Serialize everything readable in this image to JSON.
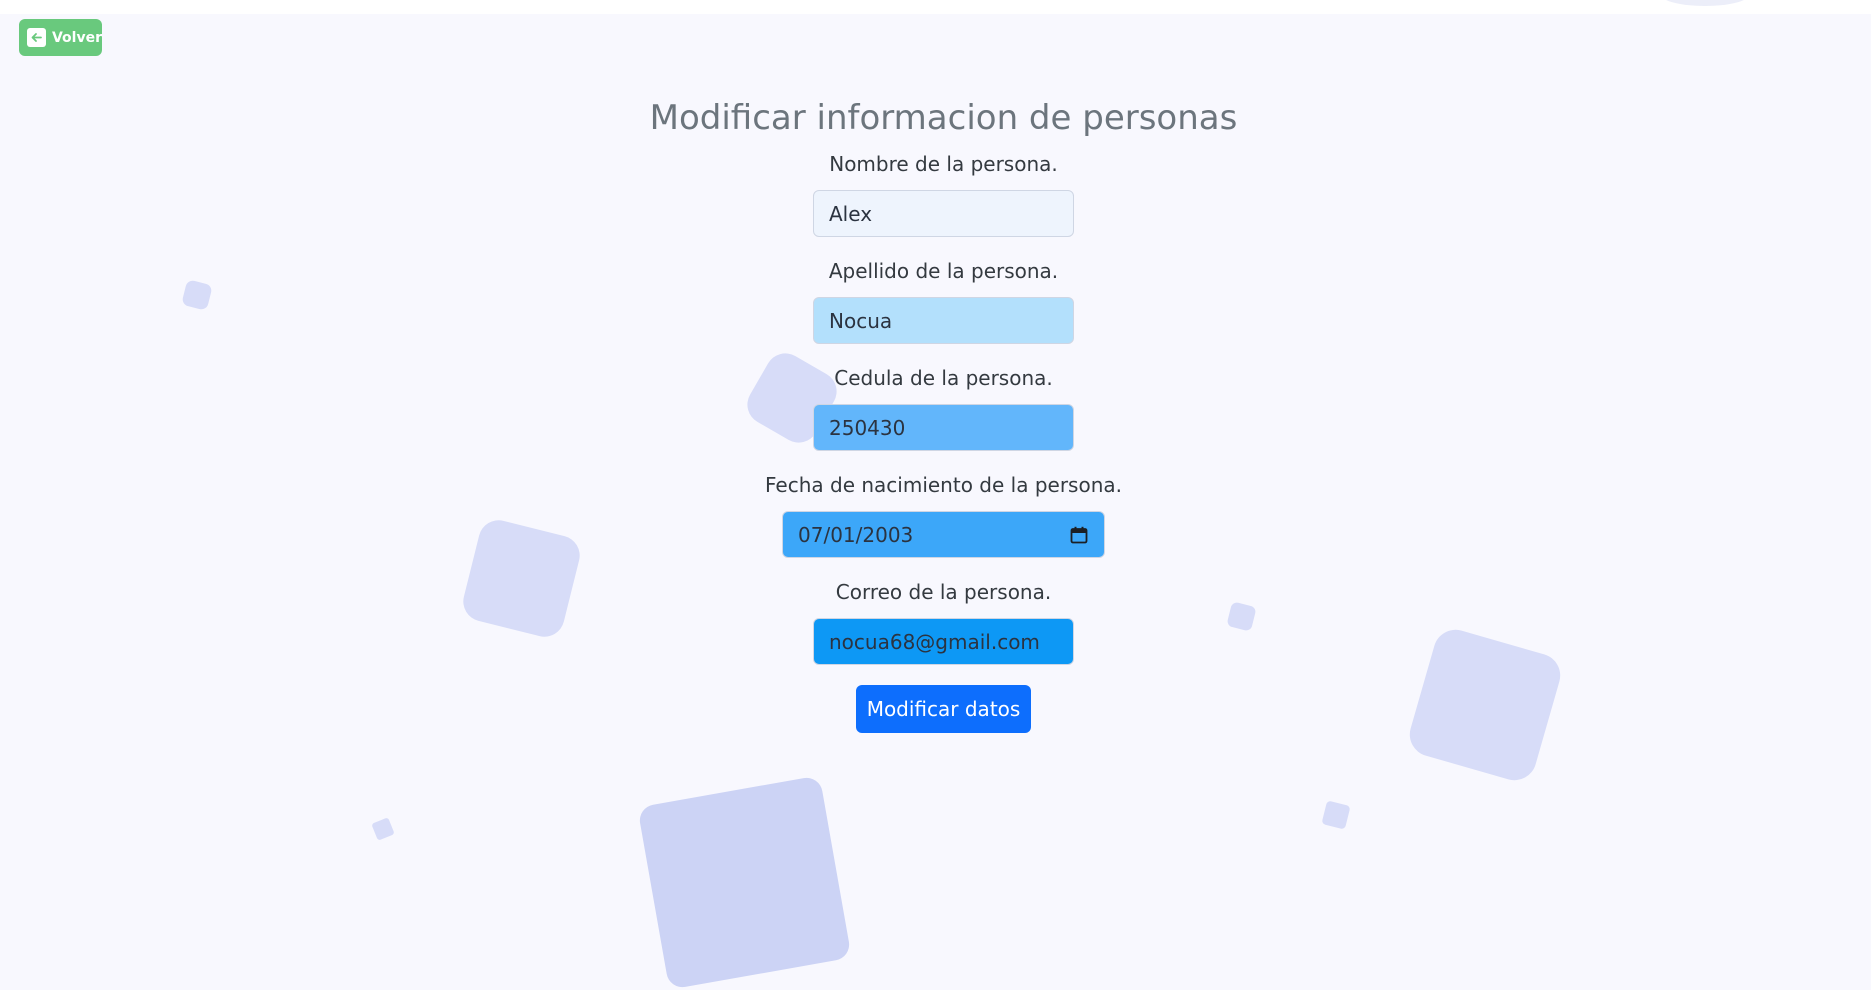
{
  "header": {
    "back_label": "Volver"
  },
  "page": {
    "title": "Modificar informacion de personas"
  },
  "form": {
    "nombre_label": "Nombre de la persona.",
    "nombre_value": "Alex",
    "apellido_label": "Apellido de la persona.",
    "apellido_value": "Nocua",
    "cedula_label": "Cedula de la persona.",
    "cedula_value": "250430",
    "fecha_label": "Fecha de nacimiento de la persona.",
    "fecha_value": "07/01/2003",
    "correo_label": "Correo de la persona.",
    "correo_value": "nocua68@gmail.com",
    "submit_label": "Modificar datos"
  },
  "colors": {
    "back_button": "#69c97d",
    "submit_button": "#0d6efd",
    "field_nombre": "#eef4fd",
    "field_apellido": "#b3e0fc",
    "field_cedula": "#62b6fb",
    "field_fecha": "#3ca7f9",
    "field_correo": "#0d98f5"
  },
  "icons": {
    "back": "arrow-left-icon",
    "date": "calendar-icon"
  }
}
